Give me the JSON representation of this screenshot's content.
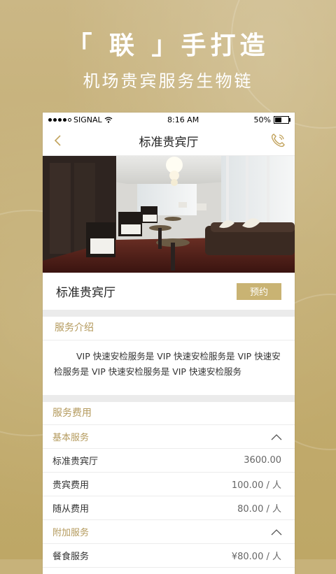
{
  "promo": {
    "headline": "「 联 」手打造",
    "subline": "机场贵宾服务生物链"
  },
  "status_bar": {
    "signal": "SIGNAL",
    "time": "8:16 AM",
    "battery": "50%"
  },
  "nav": {
    "title": "标准贵宾厅"
  },
  "hall": {
    "name": "标准贵宾厅",
    "book_label": "预约"
  },
  "intro": {
    "heading": "服务介绍",
    "text": "VIP 快速安检服务是 VIP 快速安检服务是 VIP 快速安检服务是 VIP 快速安检服务是 VIP 快速安检服务"
  },
  "fees": {
    "heading": "服务费用",
    "groups": [
      {
        "label": "基本服务",
        "rows": [
          {
            "name": "标准贵宾厅",
            "value": "3600.00"
          },
          {
            "name": "贵宾费用",
            "value": "100.00 / 人"
          },
          {
            "name": "随从费用",
            "value": "80.00 / 人"
          }
        ]
      },
      {
        "label": "附加服务",
        "rows": [
          {
            "name": "餐食服务",
            "value": "¥80.00 / 人"
          }
        ]
      }
    ]
  },
  "colors": {
    "accent": "#c9b373",
    "accent_text": "#b49a5d",
    "background": "#c7b27a"
  },
  "icons": {
    "back": "chevron-left-icon",
    "call": "phone-icon",
    "collapse": "chevron-up-icon"
  }
}
